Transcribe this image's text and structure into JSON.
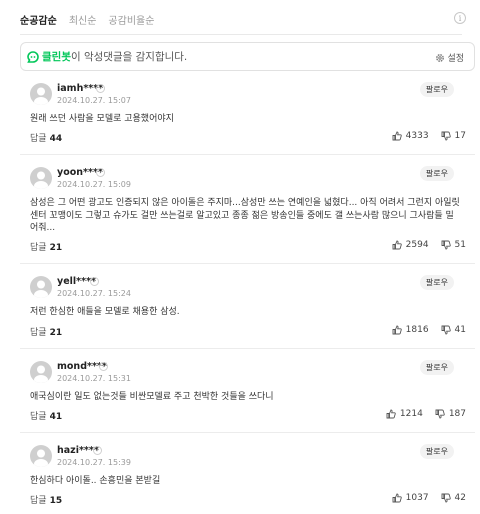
{
  "sort": {
    "tabs": [
      "순공감순",
      "최신순",
      "공감비율순"
    ],
    "active_index": 0
  },
  "info_icon": "info-icon",
  "cleanbot": {
    "brand": "클린봇",
    "text": "이 악성댓글을 감지합니다.",
    "settings_label": "설정"
  },
  "follow_label": "팔로우",
  "reply_label": "답글",
  "colors": {
    "brand_green": "#03c75a",
    "avatar_gray": "#cfcfcf",
    "follow_bg": "#f2f2f2"
  },
  "comments": [
    {
      "username": "iamh****",
      "timestamp": "2024.10.27. 15:07",
      "body": "원래 쓰던 사람을 모델로 고용했어야지",
      "replies": "44",
      "likes": "4333",
      "dislikes": "17"
    },
    {
      "username": "yoon****",
      "timestamp": "2024.10.27. 15:09",
      "body": "삼성은 그 어떤 광고도 인증되지 않은 아이돌은 주지마...삼성만 쓰는 연예인을 넓혔다... 아직 어려서 그런지 아일릿 센터 꼬맹이도 그렇고 슈가도 걸만 쓰는걸로 알고있고 종종 젊은 방송인들 중에도 갤 쓰는사람 많으니 그사람들 밀어줘...",
      "replies": "21",
      "likes": "2594",
      "dislikes": "51"
    },
    {
      "username": "yell****",
      "timestamp": "2024.10.27. 15:24",
      "body": "저런 한심한 애들을 모델로 채용한 삼성.",
      "replies": "21",
      "likes": "1816",
      "dislikes": "41"
    },
    {
      "username": "mond****",
      "timestamp": "2024.10.27. 15:31",
      "body": "애국심이란 일도 없는것들 비싼모델료 주고 천박한 것들을 쓰다니",
      "replies": "41",
      "likes": "1214",
      "dislikes": "187"
    },
    {
      "username": "hazi****",
      "timestamp": "2024.10.27. 15:39",
      "body": "한심하다 아이돌.. 손흥민을 본받길",
      "replies": "15",
      "likes": "1037",
      "dislikes": "42"
    }
  ]
}
